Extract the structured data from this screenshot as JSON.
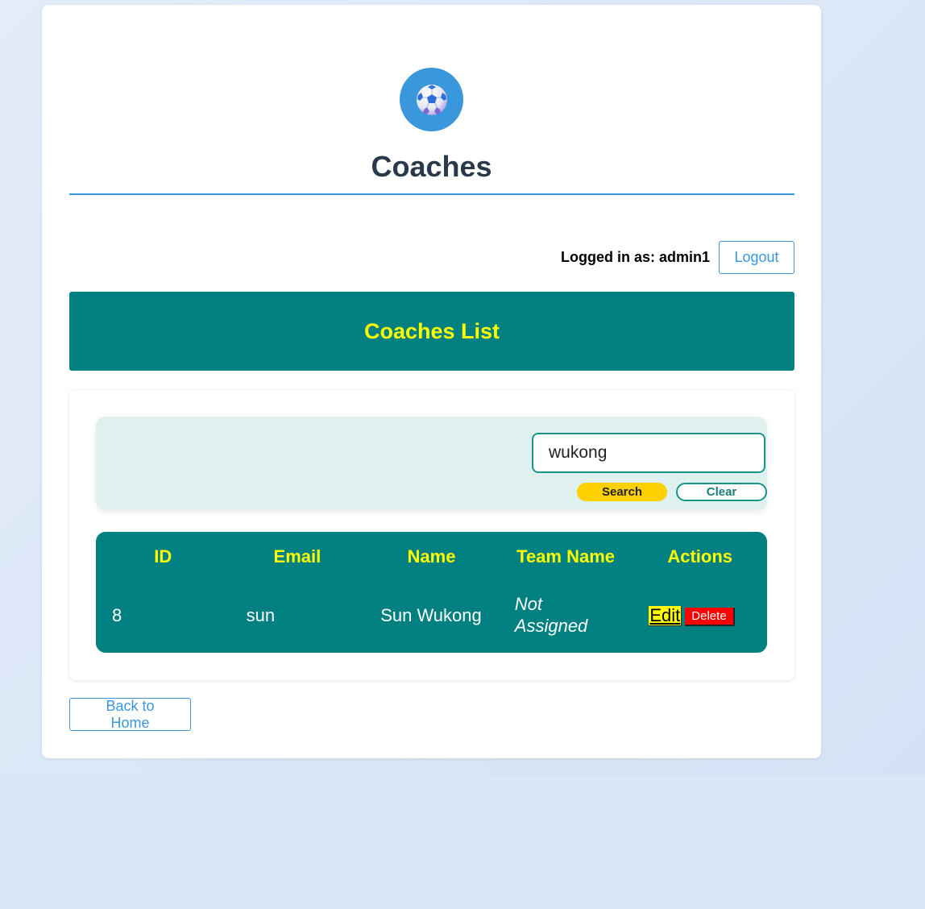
{
  "page": {
    "title": "Coaches",
    "logo_icon": "soccer-ball-icon"
  },
  "user_bar": {
    "logged_in_text": "Logged in as: admin1",
    "logout_label": "Logout"
  },
  "list_header": {
    "title": "Coaches List"
  },
  "search": {
    "value": "wukong",
    "search_label": "Search",
    "clear_label": "Clear"
  },
  "table": {
    "headers": [
      "ID",
      "Email",
      "Name",
      "Team Name",
      "Actions"
    ],
    "rows": [
      {
        "id": "8",
        "email": "sun",
        "name": "Sun Wukong",
        "team_name": "Not Assigned",
        "edit_label": "Edit",
        "delete_label": "Delete"
      }
    ]
  },
  "footer": {
    "back_label": "Back to Home"
  },
  "colors": {
    "background": "#dbe6f7",
    "accent_blue": "#3a97dc",
    "teal": "#008080",
    "header_yellow": "#ffff00",
    "search_yellow": "#ffd000",
    "delete_red": "#ff0000"
  }
}
